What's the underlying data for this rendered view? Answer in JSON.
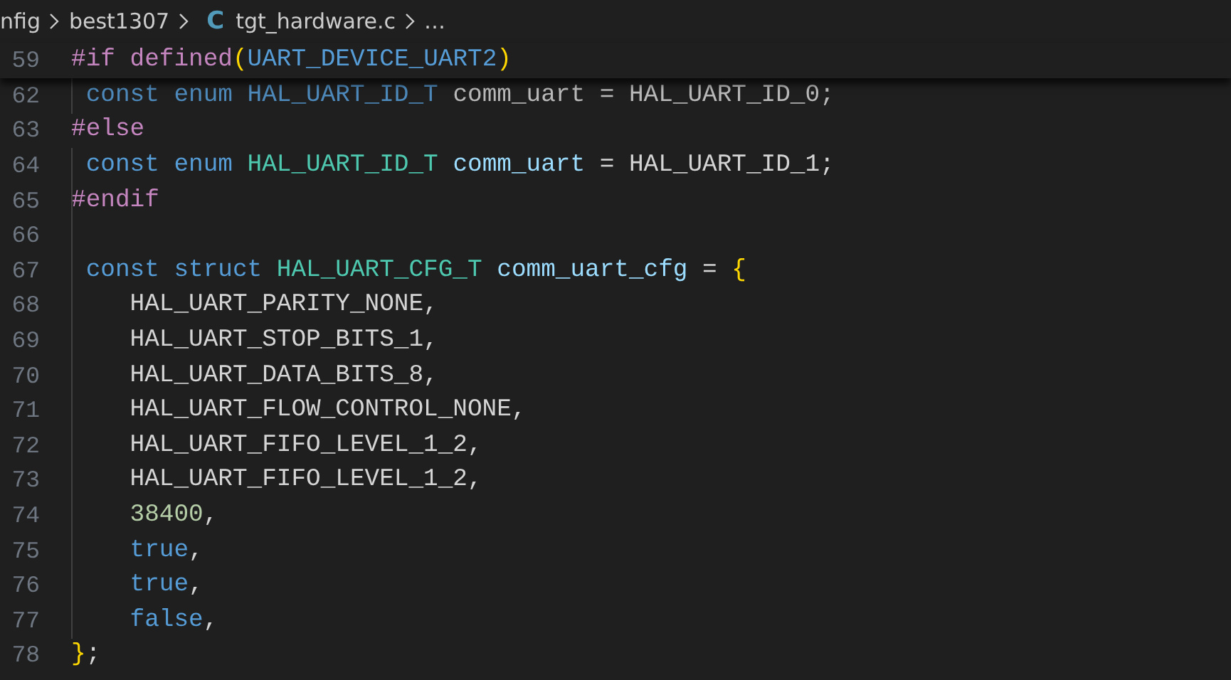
{
  "breadcrumb": {
    "items": [
      {
        "text": "nfig",
        "kind": "folder"
      },
      {
        "text": "best1307",
        "kind": "folder"
      },
      {
        "text": "tgt_hardware.c",
        "kind": "c-file",
        "icon": "C"
      },
      {
        "text": "…",
        "kind": "more"
      }
    ]
  },
  "sticky_line": {
    "number": "59",
    "tokens": [
      {
        "text": "#if",
        "kind": "directive"
      },
      {
        "text": " defined",
        "kind": "directive"
      },
      {
        "text": "(",
        "kind": "bracket"
      },
      {
        "text": "UART_DEVICE_UART2",
        "kind": "keyword"
      },
      {
        "text": ")",
        "kind": "bracket"
      }
    ]
  },
  "partial_line": {
    "number": "62",
    "tokens": [
      {
        "text": " const",
        "kind": "keyword"
      },
      {
        "text": " enum",
        "kind": "keyword"
      },
      {
        "text": " HAL_UART_ID_T",
        "kind": "keyword"
      },
      {
        "text": " comm_uart = HAL_UART_ID_0;",
        "kind": "plain"
      }
    ]
  },
  "lines": [
    {
      "number": "63",
      "tokens": [
        {
          "text": "#else",
          "kind": "directive"
        }
      ]
    },
    {
      "number": "64",
      "tokens": [
        {
          "text": " const",
          "kind": "keyword"
        },
        {
          "text": " enum",
          "kind": "keyword"
        },
        {
          "text": " HAL_UART_ID_T",
          "kind": "type"
        },
        {
          "text": " comm_uart",
          "kind": "variable"
        },
        {
          "text": " = HAL_UART_ID_1;",
          "kind": "plain"
        }
      ]
    },
    {
      "number": "65",
      "tokens": [
        {
          "text": "#endif",
          "kind": "directive"
        }
      ]
    },
    {
      "number": "66"
    },
    {
      "number": "67",
      "tokens": [
        {
          "text": " const",
          "kind": "keyword"
        },
        {
          "text": " struct",
          "kind": "keyword"
        },
        {
          "text": " HAL_UART_CFG_T",
          "kind": "type"
        },
        {
          "text": " comm_uart_cfg",
          "kind": "variable"
        },
        {
          "text": " =",
          "kind": "plain"
        },
        {
          "text": " {",
          "kind": "bracket"
        }
      ]
    },
    {
      "number": "68",
      "tokens": [
        {
          "text": "    HAL_UART_PARITY_NONE,",
          "kind": "plain"
        }
      ]
    },
    {
      "number": "69",
      "tokens": [
        {
          "text": "    HAL_UART_STOP_BITS_1,",
          "kind": "plain"
        }
      ]
    },
    {
      "number": "70",
      "tokens": [
        {
          "text": "    HAL_UART_DATA_BITS_8,",
          "kind": "plain"
        }
      ]
    },
    {
      "number": "71",
      "tokens": [
        {
          "text": "    HAL_UART_FLOW_CONTROL_NONE,",
          "kind": "plain"
        }
      ]
    },
    {
      "number": "72",
      "tokens": [
        {
          "text": "    HAL_UART_FIFO_LEVEL_1_2,",
          "kind": "plain"
        }
      ]
    },
    {
      "number": "73",
      "tokens": [
        {
          "text": "    HAL_UART_FIFO_LEVEL_1_2,",
          "kind": "plain"
        }
      ]
    },
    {
      "number": "74",
      "tokens": [
        {
          "text": "    38400",
          "kind": "number"
        },
        {
          "text": ",",
          "kind": "plain"
        }
      ]
    },
    {
      "number": "75",
      "tokens": [
        {
          "text": "    true",
          "kind": "keyword"
        },
        {
          "text": ",",
          "kind": "plain"
        }
      ]
    },
    {
      "number": "76",
      "tokens": [
        {
          "text": "    true",
          "kind": "keyword"
        },
        {
          "text": ",",
          "kind": "plain"
        }
      ]
    },
    {
      "number": "77",
      "tokens": [
        {
          "text": "    false",
          "kind": "keyword"
        },
        {
          "text": ",",
          "kind": "plain"
        }
      ]
    },
    {
      "number": "78",
      "tokens": [
        {
          "text": "}",
          "kind": "bracket"
        },
        {
          "text": ";",
          "kind": "plain"
        }
      ]
    }
  ]
}
